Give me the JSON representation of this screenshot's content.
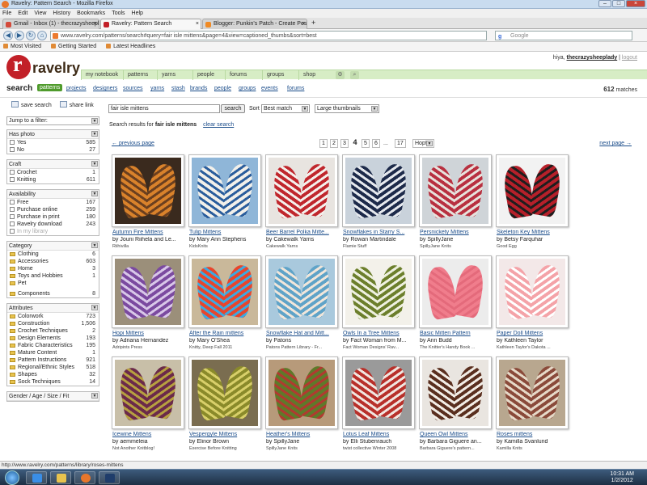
{
  "browser": {
    "title": "Ravelry: Pattern Search - Mozilla Firefox",
    "menu": [
      "File",
      "Edit",
      "View",
      "History",
      "Bookmarks",
      "Tools",
      "Help"
    ],
    "tabs": [
      {
        "label": "Gmail - Inbox (1) - thecrazysheeplady...",
        "active": false,
        "color": "#d44a3a"
      },
      {
        "label": "Ravelry: Pattern Search",
        "active": true,
        "color": "#c22028"
      },
      {
        "label": "Blogger: Punkin's Patch - Create Post",
        "active": false,
        "color": "#f08a24"
      }
    ],
    "url": "www.ravelry.com/patterns/search#query=fair isle mittens&page=4&view=captioned_thumbs&sort=best",
    "search_placeholder": "Google",
    "bookmarks": [
      "Most Visited",
      "Getting Started",
      "Latest Headlines"
    ],
    "status_url": "http://www.ravelry.com/patterns/library/roses-mittens"
  },
  "site": {
    "logo_text": "ravelry",
    "nav": [
      "my notebook",
      "patterns",
      "yarns",
      "people",
      "forums",
      "groups",
      "shop"
    ],
    "greeting_prefix": "hiya,",
    "username": "thecrazysheeplady",
    "logout": "logout"
  },
  "subnav": {
    "title": "search",
    "items": [
      "patterns",
      "projects",
      "designers",
      "sources",
      "yarns",
      "stash",
      "brands",
      "people",
      "groups",
      "events",
      "forums"
    ],
    "active": "patterns",
    "match_count": "612",
    "match_label": "matches"
  },
  "sidebar": {
    "save_search": "save search",
    "share_link": "share link",
    "jump_label": "Jump to a filter:",
    "facets": [
      {
        "title": "Has photo",
        "type": "check",
        "rows": [
          {
            "label": "Yes",
            "count": "585"
          },
          {
            "label": "No",
            "count": "27"
          }
        ]
      },
      {
        "title": "Craft",
        "type": "check",
        "rows": [
          {
            "label": "Crochet",
            "count": "1"
          },
          {
            "label": "Knitting",
            "count": "611"
          }
        ]
      },
      {
        "title": "Availability",
        "type": "check",
        "rows": [
          {
            "label": "Free",
            "count": "167"
          },
          {
            "label": "Purchase online",
            "count": "259"
          },
          {
            "label": "Purchase in print",
            "count": "180"
          },
          {
            "label": "Ravelry download",
            "count": "243"
          },
          {
            "label": "In my library",
            "count": "",
            "dim": true
          }
        ]
      },
      {
        "title": "Category",
        "type": "folder",
        "rows": [
          {
            "label": "Clothing",
            "count": "6"
          },
          {
            "label": "Accessories",
            "count": "603"
          },
          {
            "label": "Home",
            "count": "3"
          },
          {
            "label": "Toys and Hobbies",
            "count": "1"
          },
          {
            "label": "Pet",
            "count": ""
          },
          {
            "label": "Components",
            "count": "8",
            "gap": true
          }
        ]
      },
      {
        "title": "Attributes",
        "type": "folder",
        "rows": [
          {
            "label": "Colorwork",
            "count": "723"
          },
          {
            "label": "Construction",
            "count": "1,506"
          },
          {
            "label": "Crochet Techniques",
            "count": "2"
          },
          {
            "label": "Design Elements",
            "count": "193"
          },
          {
            "label": "Fabric Characteristics",
            "count": "195"
          },
          {
            "label": "Mature Content",
            "count": "1"
          },
          {
            "label": "Pattern Instructions",
            "count": "921"
          },
          {
            "label": "Regional/Ethnic Styles",
            "count": "518"
          },
          {
            "label": "Shapes",
            "count": "32"
          },
          {
            "label": "Sock Techniques",
            "count": "14"
          }
        ]
      },
      {
        "title": "Gender / Age / Size / Fit",
        "type": "folder",
        "rows": []
      }
    ]
  },
  "search": {
    "query": "fair isle mittens",
    "button": "search",
    "sort_label": "Sort",
    "sort_value": "Best match",
    "view_value": "Large thumbnails",
    "results_prefix": "Search results for",
    "results_query": "fair isle mittens",
    "clear": "clear search"
  },
  "pager": {
    "prev": "← previous page",
    "next": "next page →",
    "pages": [
      "1",
      "2",
      "3",
      "4",
      "5",
      "6"
    ],
    "current": "4",
    "ellipsis": "...",
    "last": "17",
    "hop": "Hop!"
  },
  "patterns": [
    {
      "title": "Autumn Fire Mittens",
      "by": "by Jouni Riihela and Le...",
      "src": "Riihivilla",
      "bg": "#3a2a1e",
      "c1": "#d9822b",
      "c2": "#6b3f1f"
    },
    {
      "title": "Tulip Mittens",
      "by": "by Mary Ann Stephens",
      "src": "KidsKnits",
      "bg": "#8fb6d8",
      "c1": "#f2f0ea",
      "c2": "#2a5d9c"
    },
    {
      "title": "Beer Barrel Polka Mitte...",
      "by": "by Cakewalk Yarns",
      "src": "Cakewalk Yarns",
      "bg": "#e8e4e0",
      "c1": "#c0272d",
      "c2": "#f4f0ec"
    },
    {
      "title": "Snowflakes in Starry S...",
      "by": "by Rowan Martindale",
      "src": "Flamie Stuff",
      "bg": "#c9d2db",
      "c1": "#1d2a4a",
      "c2": "#e6e9ee"
    },
    {
      "title": "Persnickety Mittens",
      "by": "by SpillyJane",
      "src": "SpillyJane Knits",
      "bg": "#cfd4d8",
      "c1": "#b83040",
      "c2": "#e7e2dc"
    },
    {
      "title": "Skeleton Key Mittens",
      "by": "by Betsy Farquhar",
      "src": "Good Egg",
      "bg": "#f2f2f2",
      "c1": "#b6202a",
      "c2": "#1e1e1e"
    },
    {
      "title": "Hopi Mittens",
      "by": "by Adriana Hernandez",
      "src": "Adripints Press",
      "bg": "#9b8f7a",
      "c1": "#7b4aa0",
      "c2": "#d8c7e8"
    },
    {
      "title": "After the Rain mittens",
      "by": "by Mary O'Shea",
      "src": "Knitty, Deep Fall 2011",
      "bg": "#c9b89a",
      "c1": "#e8452c",
      "c2": "#3ca9e0"
    },
    {
      "title": "Snowflake Hat and Mitt...",
      "by": "by Patons",
      "src": "Patons Pattern Library - Fr...",
      "bg": "#a9c9dd",
      "c1": "#5fa3c8",
      "c2": "#f1e6da"
    },
    {
      "title": "Owls In a Tree Mittens",
      "by": "by Fact Woman from M...",
      "src": "Fact Woman Designs' Rav...",
      "bg": "#f3f1ea",
      "c1": "#6c7f2c",
      "c2": "#eef0e0"
    },
    {
      "title": "Basic Mitten Pattern",
      "by": "by Ann Budd",
      "src": "The Knitter's Handy Book ...",
      "bg": "#ececec",
      "c1": "#f07d8c",
      "c2": "#e46a7b"
    },
    {
      "title": "Paper Doll Mittens",
      "by": "by Kathleen Taylor",
      "src": "Kathleen Taylor's Dakota ...",
      "bg": "#f3e8e8",
      "c1": "#f4a3a8",
      "c2": "#ffffff"
    },
    {
      "title": "Icewine Mittens",
      "by": "by aemmeleia",
      "src": "Not Another Knitblog!",
      "bg": "#c8bfa8",
      "c1": "#6b2a4a",
      "c2": "#b6a040"
    },
    {
      "title": "Vespergyle Mittens",
      "by": "by Elinor Brown",
      "src": "Exercise Before Knitting",
      "bg": "#7a6d50",
      "c1": "#8a8a2a",
      "c2": "#d8cf6a"
    },
    {
      "title": "Heather's Mittens",
      "by": "by SpillyJane",
      "src": "SpillyJane Knits",
      "bg": "#b79a7a",
      "c1": "#5e7a2a",
      "c2": "#b03a30"
    },
    {
      "title": "Lotus Leaf Mittens",
      "by": "by Elli Stubenrauch",
      "src": "twist collective Winter 2008",
      "bg": "#9a9a9a",
      "c1": "#b8302a",
      "c2": "#f1e6e0"
    },
    {
      "title": "Queen Owl Mittens",
      "by": "by Barbara Giguere an...",
      "src": "Barbara Giguere's pattern...",
      "bg": "#e9e5e0",
      "c1": "#5a2f1f",
      "c2": "#f2ede6"
    },
    {
      "title": "Roses mittens",
      "by": "by Kamilla Svanlund",
      "src": "Kamilla Knits",
      "bg": "#b8a78f",
      "c1": "#8a4a3a",
      "c2": "#e6d9c8"
    }
  ],
  "taskbar": {
    "time": "10:31 AM",
    "date": "1/2/2012"
  }
}
